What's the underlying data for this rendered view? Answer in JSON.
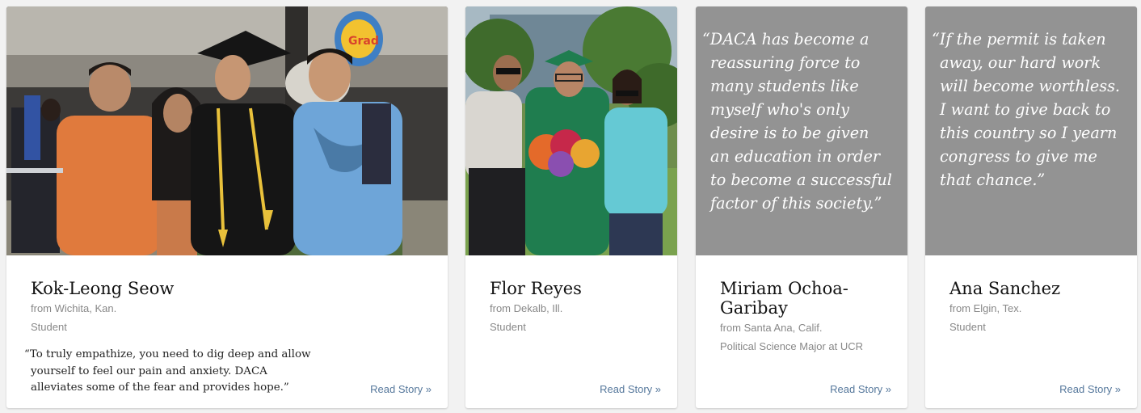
{
  "cards": [
    {
      "name": "Kok-Leong Seow",
      "hometown": "from Wichita, Kan.",
      "role": "Student",
      "pull_quote": "“To truly empathize, you need to dig deep and allow yourself to feel our pain and anxiety. DACA alleviates some of the fear and provides hope.”",
      "read_more": "Read Story »",
      "media": "photo",
      "balloon_text": "Grad"
    },
    {
      "name": "Flor Reyes",
      "hometown": "from Dekalb, Ill.",
      "role": "Student",
      "read_more": "Read Story »",
      "media": "photo"
    },
    {
      "name": "Miriam Ochoa-Garibay",
      "hometown": "from Santa Ana, Calif.",
      "role": "Political Science Major at UCR",
      "read_more": "Read Story »",
      "media": "quote",
      "quote": "“DACA has become a reassuring force to many students like myself who's only desire is to be given an education in order to become a successful factor of this society.”"
    },
    {
      "name": "Ana Sanchez",
      "hometown": "from Elgin, Tex.",
      "role": "Student",
      "read_more": "Read Story »",
      "media": "quote",
      "quote": "“If the permit is taken away, our hard work will become worthless. I want to give back to this country so I yearn congress to give me that chance.”"
    }
  ],
  "colors": {
    "page_background": "#f2f2f2",
    "quote_panel": "#939393",
    "link": "#56789c",
    "meta_text": "#888888",
    "name_text": "#121212"
  }
}
